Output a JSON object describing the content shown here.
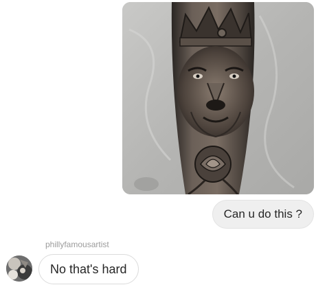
{
  "conversation": {
    "outgoing": {
      "photo_icon": "lion-crown-rose-sleeve-tattoo-photo",
      "text": "Can u do this ?"
    },
    "incoming": {
      "sender_name": "phillyfamousartist",
      "avatar_icon": "profile-avatar",
      "text": "No that's hard"
    }
  },
  "colors": {
    "outgoing_bubble": "#efefef",
    "incoming_bubble_border": "#dbdbdb",
    "sender_name": "#9b9b9b",
    "text": "#262626"
  }
}
